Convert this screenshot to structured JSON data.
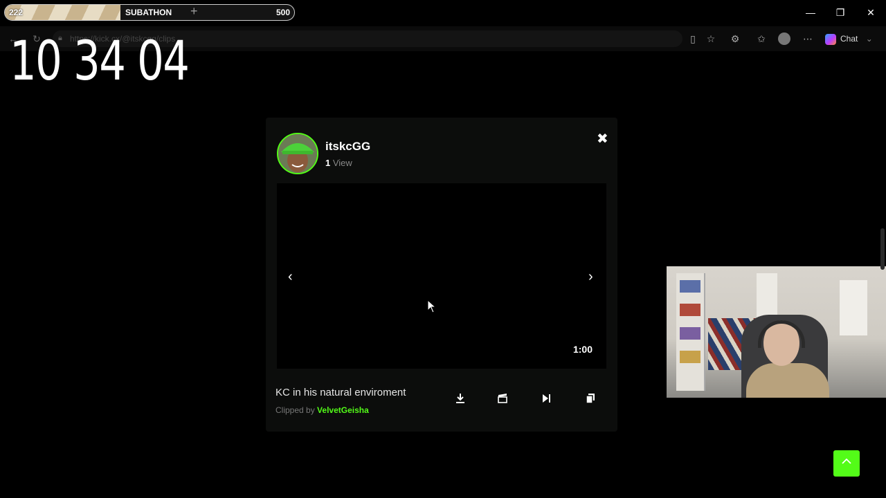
{
  "overlay": {
    "subathon_start": "222",
    "subathon_label": "SUBATHON",
    "subathon_plus": "+",
    "subathon_end": "500",
    "subathon_progress": 0.4,
    "timer": "10 34 04"
  },
  "window_controls": {
    "minimize": "—",
    "restore": "❐",
    "close": "✕"
  },
  "browser": {
    "url": "https://kick.cx/@itskcgg/clips",
    "chat_label": "Chat"
  },
  "clip_modal": {
    "streamer_name": "itskcGG",
    "view_count": "1",
    "view_label": "View",
    "duration": "1:00",
    "title": "KC in his natural enviroment",
    "clipped_by_label": "Clipped by",
    "clipped_by_user": "VelvetGeisha",
    "prev_arrow": "‹",
    "next_arrow": "›",
    "close": "✖"
  },
  "colors": {
    "kick_green": "#53fc18",
    "background": "#000000",
    "modal_bg": "#0c0d0c"
  }
}
